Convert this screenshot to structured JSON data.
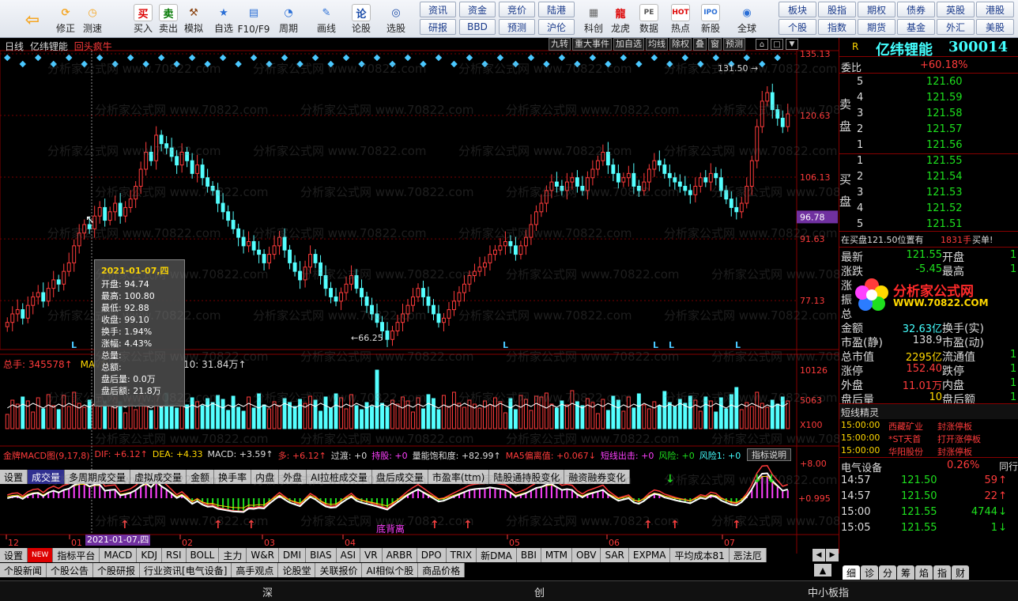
{
  "toolbar": {
    "buttons": [
      {
        "label": "",
        "icon": "back-arrow-icon"
      },
      {
        "label": "修正",
        "icon": "fix-icon"
      },
      {
        "label": "测速",
        "icon": "speed-icon"
      },
      {
        "label": "买入",
        "icon": "buy-icon",
        "glyph": "买"
      },
      {
        "label": "卖出",
        "icon": "sell-icon",
        "glyph": "卖"
      },
      {
        "label": "模拟",
        "icon": "hammer-icon"
      },
      {
        "label": "自选",
        "icon": "star-icon"
      },
      {
        "label": "F10/F9",
        "icon": "f10-icon"
      },
      {
        "label": "周期",
        "icon": "clock-icon"
      },
      {
        "label": "画线",
        "icon": "pencil-icon"
      },
      {
        "label": "论股",
        "icon": "discuss-icon",
        "glyph": "论"
      },
      {
        "label": "选股",
        "icon": "select-icon"
      }
    ],
    "grid_left": [
      [
        "资讯",
        "资金",
        "竞价",
        "陆港"
      ],
      [
        "研报",
        "BBD",
        "预测",
        "沪伦"
      ]
    ],
    "mid_buttons": [
      {
        "label": "科创",
        "icon": "chart-icon"
      },
      {
        "label": "龙虎",
        "icon": "dragon-icon"
      },
      {
        "label": "数据",
        "icon": "pe-icon",
        "glyph": "PE"
      },
      {
        "label": "热点",
        "icon": "hot-icon",
        "glyph": "HOT"
      },
      {
        "label": "新股",
        "icon": "ipo-icon",
        "glyph": "IPO"
      },
      {
        "label": "全球",
        "icon": "globe-icon"
      }
    ],
    "grid_right": [
      [
        "板块",
        "股指",
        "期权",
        "债券",
        "英股",
        "港股"
      ],
      [
        "个股",
        "指数",
        "期货",
        "基金",
        "外汇",
        "美股"
      ]
    ]
  },
  "chart_header": {
    "period": "日线",
    "name": "亿纬锂能",
    "indicator": "回头疯牛",
    "buttons": [
      "九转",
      "重大事件",
      "加自选",
      "均线",
      "除权",
      "叠",
      "窗",
      "预测"
    ],
    "price_labels": [
      "135.13",
      "120.63",
      "106.13",
      "96.78",
      "91.63",
      "77.13"
    ],
    "high_mark": "131.50",
    "low_mark": "66.25"
  },
  "tooltip": {
    "date": "2021-01-07,四",
    "lines": [
      "开盘: 94.74",
      "最高: 100.80",
      "最低: 92.88",
      "收盘: 99.10",
      "换手: 1.94%",
      "涨幅: 4.43%",
      "总量:",
      "总额:",
      "盘后量: 0.0万",
      "盘后额: 21.8万"
    ]
  },
  "volume": {
    "header_total": "总手: 345578↑",
    "header_mavol": "MAVO",
    "header_ma10": "10: 31.84万↑",
    "labels": [
      "10126",
      "5063",
      "X100"
    ]
  },
  "vol_tabs": [
    "设置",
    "成交量",
    "多周期成交量",
    "虚拟成交量",
    "金额",
    "换手率",
    "内盘",
    "外盘",
    "AI拉桩成交量",
    "盘后成交量",
    "市盈率(ttm)",
    "陆股通持股变化",
    "融资融券变化"
  ],
  "macd": {
    "title": "金牌MACD图(9,17,8)",
    "items": [
      {
        "t": "DIF: +6.12↑",
        "c": "#ff3b3b"
      },
      {
        "t": "DEA: +4.33",
        "c": "#ffd800"
      },
      {
        "t": "MACD: +3.59↑",
        "c": "#ddd"
      },
      {
        "t": "多: +6.12↑",
        "c": "#ff3b3b"
      },
      {
        "t": "过渡: +0",
        "c": "#ddd"
      },
      {
        "t": "持股: +0",
        "c": "#ff40ff"
      },
      {
        "t": "量能饱和度: +82.99↑",
        "c": "#ddd"
      },
      {
        "t": "MA5偏离值: +0.067↓",
        "c": "#ff3b3b"
      },
      {
        "t": "短线出击: +0",
        "c": "#ff40ff"
      },
      {
        "t": "风险: +0",
        "c": "#1ee01e"
      },
      {
        "t": "风险1: +0",
        "c": "#4ff"
      }
    ],
    "help": "指标说明",
    "labels": [
      "+8.00",
      "+0.995"
    ],
    "annotation": "底背离"
  },
  "xaxis": {
    "labels": [
      "12",
      "01",
      "02",
      "03",
      "04",
      "05",
      "06",
      "07"
    ],
    "cursor_date": "2021-01-07,四"
  },
  "ind_tabs": [
    "设置",
    "NEW",
    "指标平台",
    "MACD",
    "KDJ",
    "RSI",
    "BOLL",
    "主力",
    "W&R",
    "DMI",
    "BIAS",
    "ASI",
    "VR",
    "ARBR",
    "DPO",
    "TRIX",
    "新DMA",
    "BBI",
    "MTM",
    "OBV",
    "SAR",
    "EXPMA",
    "平均成本81",
    "恶法厄"
  ],
  "news_tabs": [
    "个股新闻",
    "个股公告",
    "个股研报",
    "行业资讯[电气设备]",
    "高手观点",
    "论股堂",
    "关联报价",
    "AI相似个股",
    "商品价格"
  ],
  "right": {
    "badge": "R",
    "name": "亿纬锂能",
    "code": "300014",
    "weibi_label": "委比",
    "weibi": "+60.18%",
    "sell_label": "卖盘",
    "buy_label": "买盘",
    "sell": [
      {
        "lv": "5",
        "p": "121.60"
      },
      {
        "lv": "4",
        "p": "121.59"
      },
      {
        "lv": "3",
        "p": "121.58"
      },
      {
        "lv": "2",
        "p": "121.57"
      },
      {
        "lv": "1",
        "p": "121.56"
      }
    ],
    "buy": [
      {
        "lv": "1",
        "p": "121.55"
      },
      {
        "lv": "2",
        "p": "121.54"
      },
      {
        "lv": "3",
        "p": "121.53"
      },
      {
        "lv": "4",
        "p": "121.52"
      },
      {
        "lv": "5",
        "p": "121.51"
      }
    ],
    "notice": "在买盘121.50位置有",
    "notice_vol": "1831手",
    "notice_tail": "买单!",
    "stats": [
      {
        "l": "最新",
        "v": "121.55",
        "c": "grn",
        "l2": "开盘",
        "v2": "1"
      },
      {
        "l": "涨跌",
        "v": "-5.45",
        "c": "grn",
        "l2": "最高",
        "v2": "1"
      },
      {
        "l": "涨",
        "v": "",
        "c": "wht",
        "l2": "",
        "v2": ""
      },
      {
        "l": "振",
        "v": "",
        "c": "wht",
        "l2": "",
        "v2": ""
      },
      {
        "l": "总",
        "v": "",
        "c": "wht",
        "l2": "",
        "v2": ""
      },
      {
        "l": "金额",
        "v": "32.63亿",
        "c": "cyan",
        "l2": "换手(实)",
        "v2": ""
      },
      {
        "l": "市盈(静)",
        "v": "138.9",
        "c": "wht",
        "l2": "市盈(动)",
        "v2": ""
      },
      {
        "l": "总市值",
        "v": "2295亿",
        "c": "yel",
        "l2": "流通值",
        "v2": "1"
      },
      {
        "l": "涨停",
        "v": "152.40",
        "c": "red",
        "l2": "跌停",
        "v2": "1"
      },
      {
        "l": "外盘",
        "v": "11.01万",
        "c": "red",
        "l2": "内盘",
        "v2": "1"
      },
      {
        "l": "盘后量",
        "v": "10",
        "c": "yel",
        "l2": "盘后额",
        "v2": "1"
      }
    ],
    "logo_title": "分析家公式网",
    "logo_url": "WWW.70822.COM",
    "short_title": "短线精灵",
    "short": [
      {
        "t": "15:00:00",
        "n": "西藏矿业",
        "e": "封涨停板"
      },
      {
        "t": "15:00:00",
        "n": "*ST天首",
        "e": "打开涨停板"
      },
      {
        "t": "15:00:00",
        "n": "华阳股份",
        "e": "封涨停板"
      }
    ],
    "sector": "电气设备",
    "sector_pct": "0.26%",
    "sector_tail": "同行业",
    "ticks": [
      {
        "t": "14:57",
        "p": "121.50",
        "v": "59",
        "d": "↑",
        "c": "red"
      },
      {
        "t": "14:57",
        "p": "121.50",
        "v": "22",
        "d": "↑",
        "c": "red"
      },
      {
        "t": "15:00",
        "p": "121.55",
        "v": "4744",
        "d": "↓",
        "c": "grn"
      },
      {
        "t": "15:05",
        "p": "121.55",
        "v": "1",
        "d": "↓",
        "c": "grn"
      }
    ],
    "bottom_tabs": [
      "细",
      "诊",
      "分",
      "筹",
      "焰",
      "指",
      "财"
    ]
  },
  "status": {
    "items": [
      "深",
      "创",
      "中小板指"
    ]
  },
  "watermark": "分析家公式网 www.70822.com",
  "chart_data": {
    "type": "candlestick",
    "ylim": [
      66,
      135.13
    ],
    "price_ticks": [
      135.13,
      120.63,
      106.13,
      91.63,
      77.13
    ],
    "current_price": 96.78,
    "high": 131.5,
    "low": 66.25,
    "x_labels": [
      "12",
      "01",
      "02",
      "03",
      "04",
      "05",
      "06",
      "07"
    ],
    "closes": [
      72,
      74,
      75,
      73,
      76,
      78,
      79,
      77,
      80,
      82,
      81,
      84,
      86,
      90,
      93,
      95,
      94,
      97,
      99,
      96,
      98,
      100,
      97,
      99,
      101,
      104,
      108,
      112,
      110,
      116,
      114,
      113,
      111,
      109,
      112,
      110,
      107,
      109,
      106,
      104,
      103,
      100,
      98,
      96,
      94,
      92,
      90,
      91,
      89,
      88,
      86,
      88,
      90,
      92,
      89,
      86,
      84,
      82,
      85,
      88,
      86,
      83,
      80,
      78,
      77,
      79,
      81,
      83,
      80,
      78,
      76,
      74,
      72,
      70,
      68,
      70,
      72,
      74,
      76,
      78,
      80,
      78,
      76,
      74,
      72,
      73,
      75,
      77,
      79,
      81,
      83,
      84,
      85,
      86,
      88,
      89,
      90,
      91,
      90,
      88,
      90,
      92,
      95,
      98,
      100,
      103,
      105,
      104,
      103,
      105,
      106,
      104,
      103,
      106,
      108,
      110,
      112,
      109,
      107,
      105,
      106,
      107,
      104,
      103,
      105,
      108,
      110,
      109,
      107,
      106,
      105,
      104,
      103,
      102,
      104,
      106,
      105,
      107,
      106,
      103,
      101,
      99,
      98,
      100,
      104,
      110,
      118,
      124,
      126,
      122,
      120,
      118,
      121
    ]
  }
}
